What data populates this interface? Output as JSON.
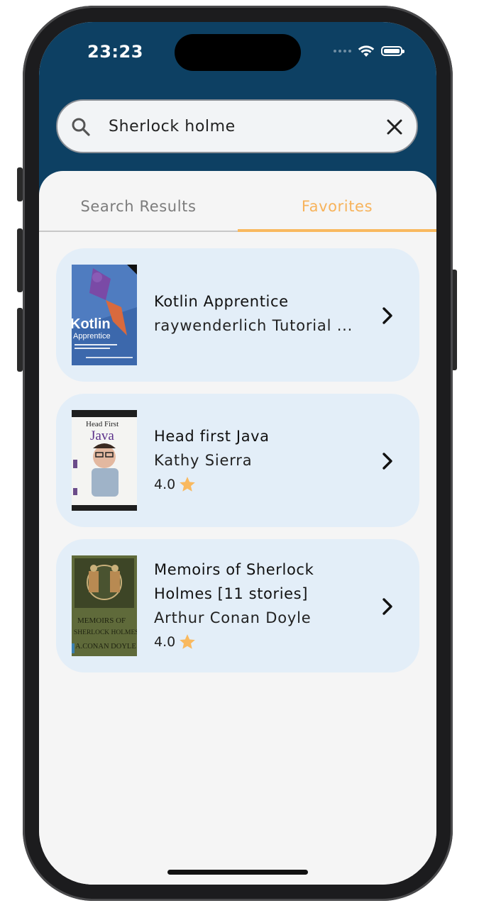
{
  "status_bar": {
    "time": "23:23"
  },
  "search": {
    "query": "Sherlock holme"
  },
  "tabs": [
    {
      "label": "Search Results",
      "active": false
    },
    {
      "label": "Favorites",
      "active": true
    }
  ],
  "books": [
    {
      "title": "Kotlin Apprentice",
      "author": "raywenderlich Tutorial ...",
      "rating": "",
      "cover_title": "Kotlin",
      "cover_subtitle": "Apprentice"
    },
    {
      "title": "Head first Java",
      "author": "Kathy Sierra",
      "rating": "4.0",
      "cover_title": "Java",
      "cover_subtitle": "Head First"
    },
    {
      "title_line1": "Memoirs of Sherlock",
      "title_line2": "Holmes [11 stories]",
      "author": "Arthur Conan Doyle",
      "rating": "4.0",
      "cover_title": "MEMOIRS OF",
      "cover_subtitle": "SHERLOCK HOLMES",
      "cover_author": "A.CONAN DOYLE"
    }
  ],
  "colors": {
    "header": "#0d4063",
    "accent": "#f9b95f",
    "card": "#e3eef8",
    "star": "#f9b95f"
  },
  "icons": [
    "search-icon",
    "close-icon",
    "chevron-right-icon",
    "star-icon",
    "wifi-icon",
    "battery-icon"
  ]
}
